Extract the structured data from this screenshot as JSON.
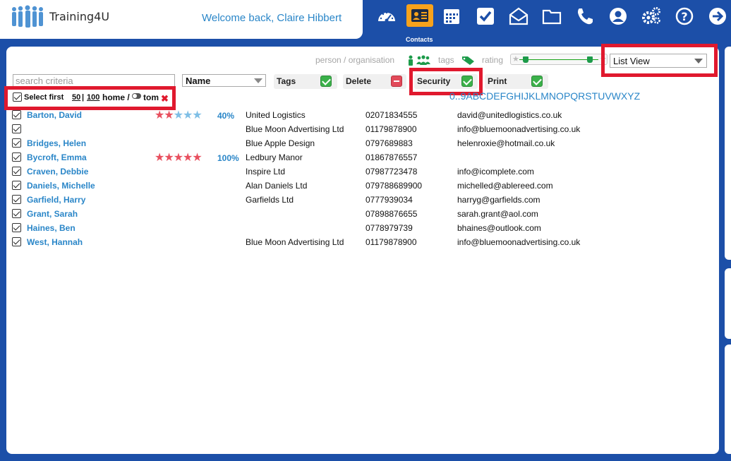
{
  "app": {
    "brand": "Training4U",
    "welcome": "Welcome back, Claire Hibbert"
  },
  "nav": {
    "active_label": "Contacts",
    "icons": [
      "dashboard-icon",
      "contacts-icon",
      "calendar-icon",
      "tasks-icon",
      "mail-icon",
      "folder-icon",
      "phone-icon",
      "user-icon",
      "settings-icon",
      "help-icon",
      "logout-icon"
    ]
  },
  "filters": {
    "person_org": "person / organisation",
    "tags": "tags",
    "rating": "rating",
    "rating_range": [
      0,
      1
    ],
    "view": "List View",
    "search_placeholder": "search criteria",
    "sort": "Name"
  },
  "toolbar": {
    "tags": "Tags",
    "delete": "Delete",
    "security": "Security",
    "print": "Print"
  },
  "selection": {
    "prefix": "Select first",
    "opt1": "50",
    "sep": "|",
    "opt2": "100",
    "home": "home /",
    "user": "tom",
    "clear": "✖"
  },
  "alphabet": [
    "0..9",
    "A",
    "B",
    "C",
    "D",
    "E",
    "F",
    "G",
    "H",
    "I",
    "J",
    "K",
    "L",
    "M",
    "N",
    "O",
    "P",
    "Q",
    "R",
    "S",
    "T",
    "U",
    "V",
    "W",
    "X",
    "Y",
    "Z"
  ],
  "contacts": [
    {
      "name": "Barton, David",
      "stars": 2,
      "pct": "40%",
      "org": "United Logistics",
      "phone": "02071834555",
      "email": "david@unitedlogistics.co.uk"
    },
    {
      "name": "",
      "stars": null,
      "pct": "",
      "org": "Blue Moon Advertising Ltd",
      "phone": "01179878900",
      "email": "info@bluemoonadvertising.co.uk"
    },
    {
      "name": "Bridges, Helen",
      "stars": null,
      "pct": "",
      "org": "Blue Apple Design",
      "phone": "0797689883",
      "email": "helenroxie@hotmail.co.uk"
    },
    {
      "name": "Bycroft, Emma",
      "stars": 5,
      "pct": "100%",
      "org": "Ledbury Manor",
      "phone": "01867876557",
      "email": ""
    },
    {
      "name": "Craven, Debbie",
      "stars": null,
      "pct": "",
      "org": "Inspire Ltd",
      "phone": "07987723478",
      "email": "info@icomplete.com"
    },
    {
      "name": "Daniels, Michelle",
      "stars": null,
      "pct": "",
      "org": "Alan Daniels Ltd",
      "phone": "079788689900",
      "email": "michelled@ablereed.com"
    },
    {
      "name": "Garfield, Harry",
      "stars": null,
      "pct": "",
      "org": "Garfields Ltd",
      "phone": "0777939034",
      "email": "harryg@garfields.com"
    },
    {
      "name": "Grant, Sarah",
      "stars": null,
      "pct": "",
      "org": "",
      "phone": "07898876655",
      "email": "sarah.grant@aol.com"
    },
    {
      "name": "Haines, Ben",
      "stars": null,
      "pct": "",
      "org": "",
      "phone": "0778979739",
      "email": "bhaines@outlook.com"
    },
    {
      "name": "West, Hannah",
      "stars": null,
      "pct": "",
      "org": "Blue Moon Advertising Ltd",
      "phone": "01179878900",
      "email": "info@bluemoonadvertising.co.uk"
    }
  ],
  "colors": {
    "brand_blue": "#1c4fa8",
    "link_blue": "#2a86c8",
    "active_orange": "#f7a21b",
    "highlight_red": "#e0192e"
  }
}
